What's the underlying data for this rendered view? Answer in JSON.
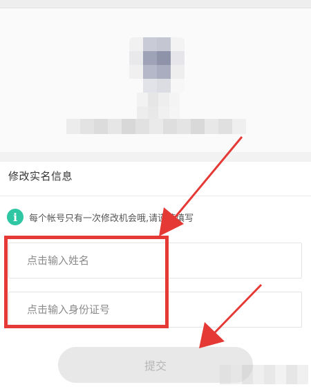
{
  "profile": {
    "avatar_desc": "pixelated avatar",
    "name_desc": "pixelated username"
  },
  "section": {
    "title": "修改实名信息"
  },
  "notice": {
    "icon": "info-icon",
    "text": "每个帐号只有一次修改机会哦,请谨慎填写"
  },
  "form": {
    "name_placeholder": "点击输入姓名",
    "id_placeholder": "点击输入身份证号",
    "submit_label": "提交"
  },
  "colors": {
    "accent_teal": "#2ec6a3",
    "annotation_red": "#e53935",
    "button_disabled_bg": "#e8e8e8"
  }
}
